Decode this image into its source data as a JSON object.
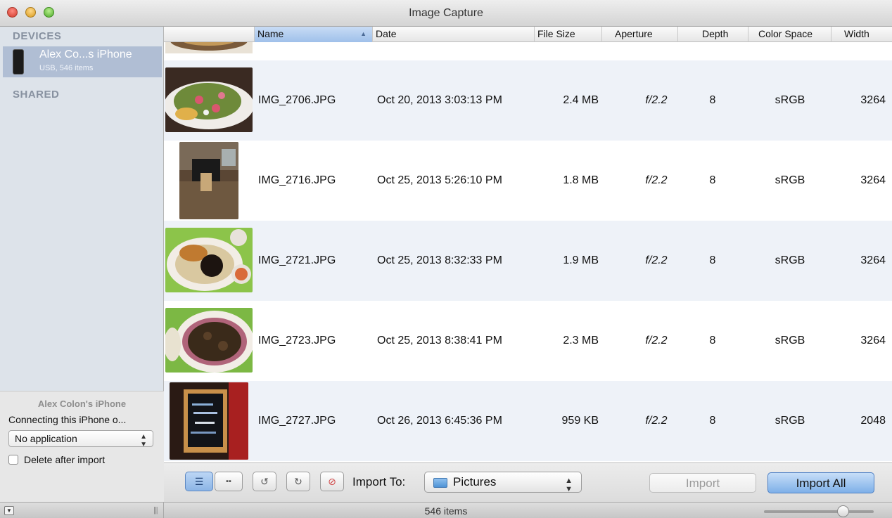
{
  "window": {
    "title": "Image Capture"
  },
  "sidebar": {
    "devices_heading": "DEVICES",
    "device": {
      "name": "Alex Co...s iPhone",
      "subtitle": "USB, 546 items"
    },
    "shared_heading": "SHARED",
    "bottom": {
      "device_label": "Alex Colon's iPhone",
      "connecting_text": "Connecting this iPhone o...",
      "app_select_value": "No application",
      "delete_label": "Delete after import",
      "delete_checked": false
    }
  },
  "table": {
    "columns": [
      {
        "key": "name",
        "label": "Name"
      },
      {
        "key": "date",
        "label": "Date"
      },
      {
        "key": "size",
        "label": "File Size"
      },
      {
        "key": "aperture",
        "label": "Aperture"
      },
      {
        "key": "depth",
        "label": "Depth"
      },
      {
        "key": "color_space",
        "label": "Color Space"
      },
      {
        "key": "width",
        "label": "Width"
      }
    ],
    "rows": [
      {
        "name": "IMG_2706.JPG",
        "date": "Oct 20, 2013 3:03:13 PM",
        "size": "2.4 MB",
        "aperture": "f/2.2",
        "depth": "8",
        "color_space": "sRGB",
        "width": "3264"
      },
      {
        "name": "IMG_2716.JPG",
        "date": "Oct 25, 2013 5:26:10 PM",
        "size": "1.8 MB",
        "aperture": "f/2.2",
        "depth": "8",
        "color_space": "sRGB",
        "width": "3264"
      },
      {
        "name": "IMG_2721.JPG",
        "date": "Oct 25, 2013 8:32:33 PM",
        "size": "1.9 MB",
        "aperture": "f/2.2",
        "depth": "8",
        "color_space": "sRGB",
        "width": "3264"
      },
      {
        "name": "IMG_2723.JPG",
        "date": "Oct 25, 2013 8:38:41 PM",
        "size": "2.3 MB",
        "aperture": "f/2.2",
        "depth": "8",
        "color_space": "sRGB",
        "width": "3264"
      },
      {
        "name": "IMG_2727.JPG",
        "date": "Oct 26, 2013 6:45:36 PM",
        "size": "959 KB",
        "aperture": "f/2.2",
        "depth": "8",
        "color_space": "sRGB",
        "width": "2048"
      }
    ]
  },
  "toolbar": {
    "import_to_label": "Import To:",
    "destination": "Pictures",
    "import_label": "Import",
    "import_all_label": "Import All",
    "icons": [
      "list-view-icon",
      "grid-view-icon",
      "rotate-left-icon",
      "rotate-right-icon",
      "delete-icon"
    ]
  },
  "statusbar": {
    "item_count": "546 items",
    "thumbnail_size_level": 0.75
  },
  "colors": {
    "selection": "#b0bed4",
    "accent": "#7eb0e8",
    "sidebar": "#dde3ea"
  }
}
